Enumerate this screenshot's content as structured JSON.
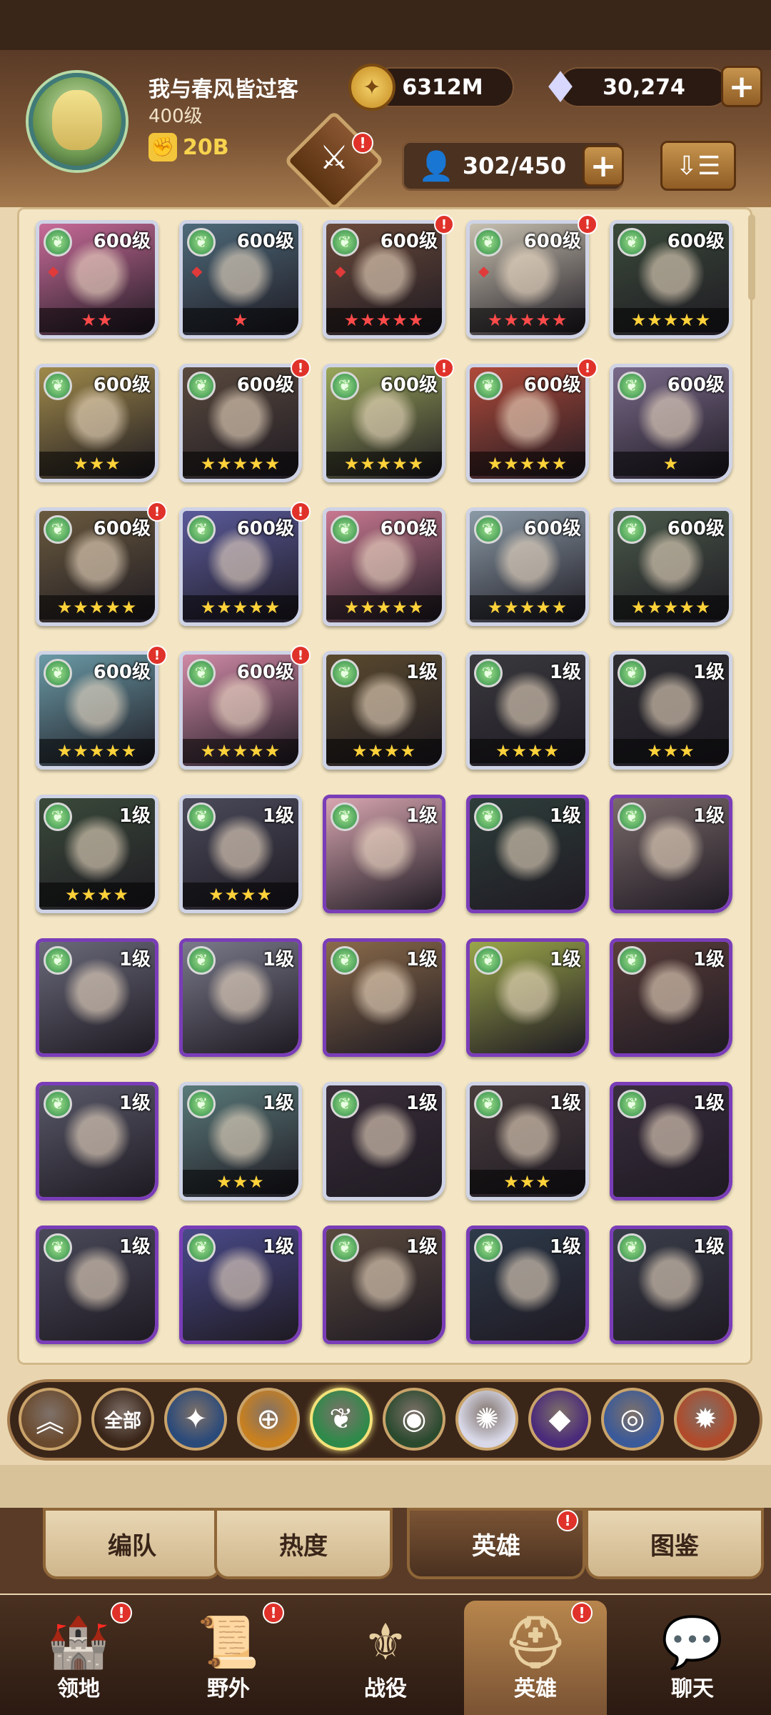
{
  "player": {
    "name": "我与春风皆过客",
    "level": "400级",
    "power": "20B"
  },
  "resources": {
    "gold": "6312M",
    "gems": "30,274"
  },
  "hero_count": "302/450",
  "heroes": [
    {
      "level": "600级",
      "stars": "★★",
      "star_color": "red",
      "alert": false,
      "frame": "silver",
      "bg": "#c86b98"
    },
    {
      "level": "600级",
      "stars": "★",
      "star_color": "red",
      "alert": false,
      "frame": "silver",
      "bg": "#4e6a7a"
    },
    {
      "level": "600级",
      "stars": "★★★★★",
      "star_color": "red",
      "alert": true,
      "frame": "silver",
      "bg": "#6b4a3a"
    },
    {
      "level": "600级",
      "stars": "★★★★★",
      "star_color": "red",
      "alert": true,
      "frame": "silver",
      "bg": "#c7c0b0"
    },
    {
      "level": "600级",
      "stars": "★★★★★",
      "star_color": "gold",
      "alert": false,
      "frame": "silver",
      "bg": "#3a4a3a"
    },
    {
      "level": "600级",
      "stars": "★★★",
      "star_color": "gold",
      "alert": false,
      "frame": "silver",
      "bg": "#a08a4a"
    },
    {
      "level": "600级",
      "stars": "★★★★★",
      "star_color": "gold",
      "alert": true,
      "frame": "silver",
      "bg": "#5a4a3e"
    },
    {
      "level": "600级",
      "stars": "★★★★★",
      "star_color": "gold",
      "alert": true,
      "frame": "silver",
      "bg": "#9aa65a"
    },
    {
      "level": "600级",
      "stars": "★★★★★",
      "star_color": "gold",
      "alert": true,
      "frame": "silver",
      "bg": "#b04a3a"
    },
    {
      "level": "600级",
      "stars": "★",
      "star_color": "gold",
      "alert": false,
      "frame": "silver",
      "bg": "#7a6a8a"
    },
    {
      "level": "600级",
      "stars": "★★★★★",
      "star_color": "gold",
      "alert": true,
      "frame": "silver",
      "bg": "#6a5a3e"
    },
    {
      "level": "600级",
      "stars": "★★★★★",
      "star_color": "gold",
      "alert": true,
      "frame": "silver",
      "bg": "#5a5a9a"
    },
    {
      "level": "600级",
      "stars": "★★★★★",
      "star_color": "gold",
      "alert": false,
      "frame": "silver",
      "bg": "#c87890"
    },
    {
      "level": "600级",
      "stars": "★★★★★",
      "star_color": "gold",
      "alert": false,
      "frame": "silver",
      "bg": "#8a9aa6"
    },
    {
      "level": "600级",
      "stars": "★★★★★",
      "star_color": "gold",
      "alert": false,
      "frame": "silver",
      "bg": "#4a5a4a"
    },
    {
      "level": "600级",
      "stars": "★★★★★",
      "star_color": "gold",
      "alert": true,
      "frame": "silver",
      "bg": "#6a9aa6"
    },
    {
      "level": "600级",
      "stars": "★★★★★",
      "star_color": "gold",
      "alert": true,
      "frame": "silver",
      "bg": "#d08aa6"
    },
    {
      "level": "1级",
      "stars": "★★★★",
      "star_color": "gold",
      "alert": false,
      "frame": "silver",
      "bg": "#5a4a2e"
    },
    {
      "level": "1级",
      "stars": "★★★★",
      "star_color": "gold",
      "alert": false,
      "frame": "silver",
      "bg": "#3a3a3e"
    },
    {
      "level": "1级",
      "stars": "★★★",
      "star_color": "gold",
      "alert": false,
      "frame": "silver",
      "bg": "#2e2e32"
    },
    {
      "level": "1级",
      "stars": "★★★★",
      "star_color": "gold",
      "alert": false,
      "frame": "silver",
      "bg": "#3a4a3a"
    },
    {
      "level": "1级",
      "stars": "★★★★",
      "star_color": "gold",
      "alert": false,
      "frame": "silver",
      "bg": "#4a4a5a"
    },
    {
      "level": "1级",
      "stars": "",
      "star_color": "gold",
      "alert": false,
      "frame": "purple",
      "bg": "#d8a6b0"
    },
    {
      "level": "1级",
      "stars": "",
      "star_color": "gold",
      "alert": false,
      "frame": "purple",
      "bg": "#2e3e3a"
    },
    {
      "level": "1级",
      "stars": "",
      "star_color": "gold",
      "alert": false,
      "frame": "purple",
      "bg": "#7a6a6a"
    },
    {
      "level": "1级",
      "stars": "",
      "star_color": "gold",
      "alert": false,
      "frame": "purple",
      "bg": "#6a6a7a"
    },
    {
      "level": "1级",
      "stars": "",
      "star_color": "gold",
      "alert": false,
      "frame": "purple",
      "bg": "#7a7a8a"
    },
    {
      "level": "1级",
      "stars": "",
      "star_color": "gold",
      "alert": false,
      "frame": "purple",
      "bg": "#8a6a4a"
    },
    {
      "level": "1级",
      "stars": "",
      "star_color": "gold",
      "alert": false,
      "frame": "purple",
      "bg": "#9aa64a"
    },
    {
      "level": "1级",
      "stars": "",
      "star_color": "gold",
      "alert": false,
      "frame": "purple",
      "bg": "#5a3e3a"
    },
    {
      "level": "1级",
      "stars": "",
      "star_color": "gold",
      "alert": false,
      "frame": "purple",
      "bg": "#5a5a6a"
    },
    {
      "level": "1级",
      "stars": "★★★",
      "star_color": "gold",
      "alert": false,
      "frame": "silver",
      "bg": "#5a7a7a"
    },
    {
      "level": "1级",
      "stars": "",
      "star_color": "gold",
      "alert": false,
      "frame": "silver",
      "bg": "#3a2e3a"
    },
    {
      "level": "1级",
      "stars": "★★★",
      "star_color": "gold",
      "alert": false,
      "frame": "silver",
      "bg": "#4a3e3e"
    },
    {
      "level": "1级",
      "stars": "",
      "star_color": "gold",
      "alert": false,
      "frame": "purple",
      "bg": "#3a2e3e"
    },
    {
      "level": "1级",
      "stars": "",
      "star_color": "gold",
      "alert": false,
      "frame": "purple",
      "bg": "#4a4a5a"
    },
    {
      "level": "1级",
      "stars": "",
      "star_color": "gold",
      "alert": false,
      "frame": "purple",
      "bg": "#4a4a8a"
    },
    {
      "level": "1级",
      "stars": "",
      "star_color": "gold",
      "alert": false,
      "frame": "purple",
      "bg": "#5a4a3e"
    },
    {
      "level": "1级",
      "stars": "",
      "star_color": "gold",
      "alert": false,
      "frame": "purple",
      "bg": "#2e3a4a"
    },
    {
      "level": "1级",
      "stars": "",
      "star_color": "gold",
      "alert": false,
      "frame": "purple",
      "bg": "#3a3e4a"
    }
  ],
  "filters": [
    {
      "name": "collapse-icon",
      "glyph": "︽",
      "label": "",
      "bg": "#6a4a2e"
    },
    {
      "name": "all-filter",
      "glyph": "",
      "label": "全部",
      "bg": "#3a2519"
    },
    {
      "name": "lightbearer-icon",
      "glyph": "✦",
      "label": "",
      "bg": "#2a4a7a"
    },
    {
      "name": "mauler-icon",
      "glyph": "⊕",
      "label": "",
      "bg": "#c9801f"
    },
    {
      "name": "wilder-icon",
      "glyph": "❦",
      "label": "",
      "bg": "#2e8a4a"
    },
    {
      "name": "graveborn-icon",
      "glyph": "◉",
      "label": "",
      "bg": "#2a4a2e"
    },
    {
      "name": "celestial-icon",
      "glyph": "✺",
      "label": "",
      "bg": "#d8d8e8"
    },
    {
      "name": "hypogean-icon",
      "glyph": "◆",
      "label": "",
      "bg": "#4a2a7a"
    },
    {
      "name": "dimensional-icon",
      "glyph": "◎",
      "label": "",
      "bg": "#3a5a9a"
    },
    {
      "name": "flame-icon",
      "glyph": "✹",
      "label": "",
      "bg": "#b04a2a"
    }
  ],
  "tabs": {
    "formation": "编队",
    "popularity": "热度",
    "heroes": "英雄",
    "codex": "图鉴"
  },
  "nav": {
    "territory": "领地",
    "wilds": "野外",
    "campaign": "战役",
    "heroes": "英雄",
    "chat": "聊天"
  },
  "alert_mark": "!"
}
